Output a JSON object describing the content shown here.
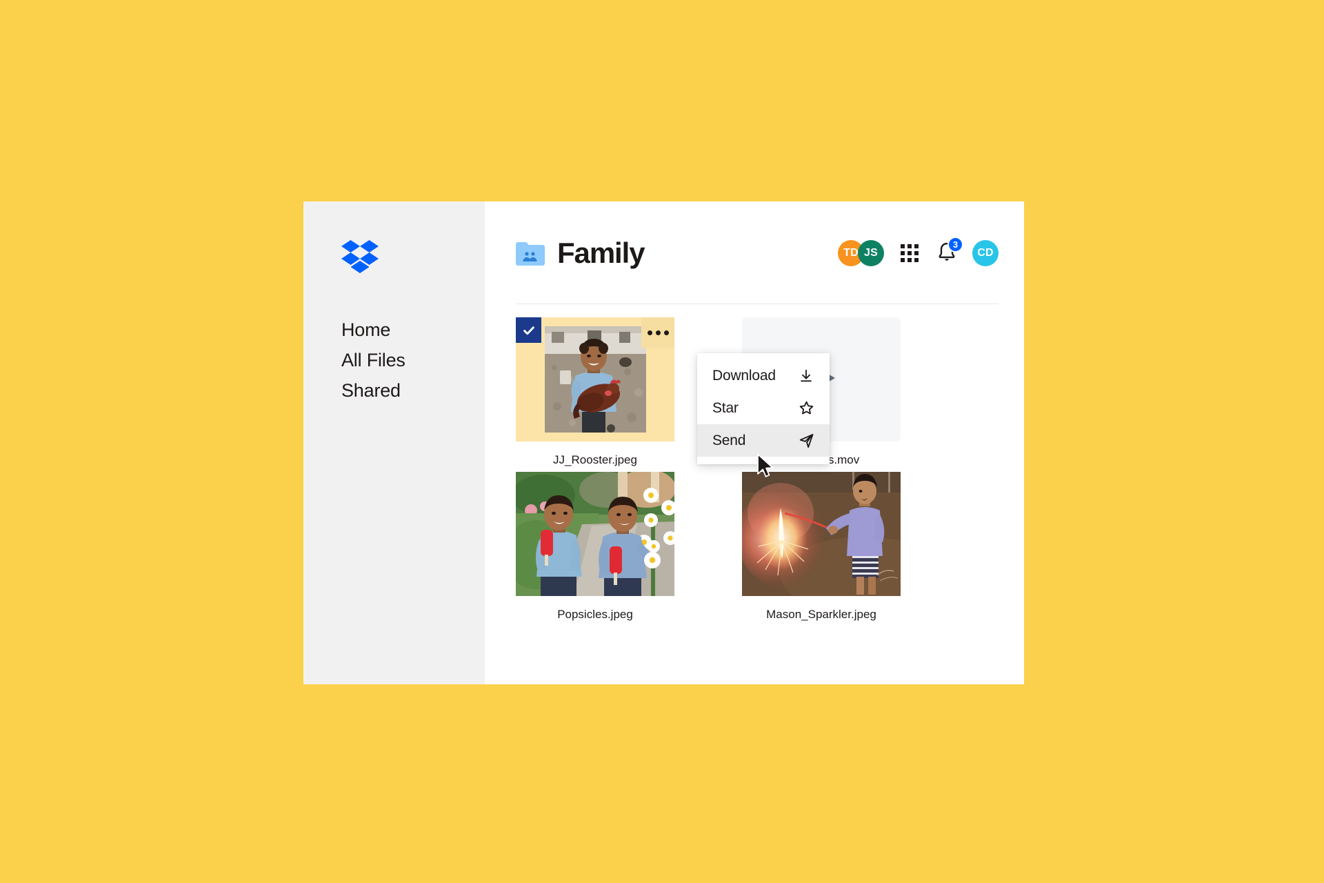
{
  "background_color": "#fbd14b",
  "app": {
    "window_background": "#ffffff",
    "sidebar": {
      "background": "#f1f1f1",
      "logo_name": "dropbox-logo",
      "logo_color": "#0061fe",
      "items": [
        {
          "label": "Home",
          "name": "sidebar-item-home"
        },
        {
          "label": "All Files",
          "name": "sidebar-item-all-files"
        },
        {
          "label": "Shared",
          "name": "sidebar-item-shared"
        }
      ]
    },
    "header": {
      "folder_icon": "shared-folder-icon",
      "folder_icon_color": "#8ecafc",
      "title": "Family",
      "avatars": [
        {
          "initials": "TD",
          "color": "#f7931e",
          "name": "avatar-td"
        },
        {
          "initials": "JS",
          "color": "#0f8163",
          "name": "avatar-js"
        }
      ],
      "apps_grid_icon": "apps-grid-icon",
      "notifications": {
        "icon": "bell-icon",
        "badge_count": "3",
        "badge_color": "#0061fe"
      },
      "account_avatar": {
        "initials": "CD",
        "color": "#29c5e8",
        "name": "avatar-cd"
      }
    },
    "files": [
      {
        "name": "JJ_Rooster.jpeg",
        "type": "image",
        "selected": true,
        "selection_color": "#1b3a8c",
        "highlight_color": "#fce4a9",
        "overflow_icon": "more-options-icon"
      },
      {
        "name": "Fireworks.mov",
        "type": "video",
        "selected": false,
        "play_icon": "play-icon",
        "play_icon_color": "#62707f",
        "tile_color": "#f5f6f7"
      },
      {
        "name": "Popsicles.jpeg",
        "type": "image",
        "selected": false
      },
      {
        "name": "Mason_Sparkler.jpeg",
        "type": "image",
        "selected": false
      }
    ],
    "context_menu": {
      "items": [
        {
          "label": "Download",
          "icon": "download-icon",
          "highlighted": false
        },
        {
          "label": "Star",
          "icon": "star-icon",
          "highlighted": false
        },
        {
          "label": "Send",
          "icon": "send-icon",
          "highlighted": true
        }
      ],
      "highlight_color": "#ebebeb"
    },
    "cursor": {
      "name": "mouse-pointer"
    }
  }
}
